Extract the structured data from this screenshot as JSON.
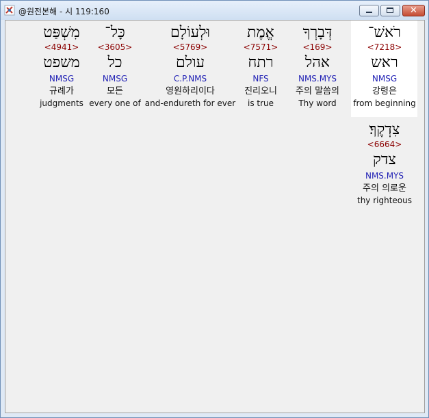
{
  "window": {
    "title": "@원전본해 - 시 119:160",
    "close_glyph": "✕"
  },
  "words": [
    {
      "hebrew": "רֹאשׁ־",
      "strong": "<7218>",
      "lemma": "ראש",
      "parse": "NMSG",
      "korean": "강령은",
      "english": "from beginning"
    },
    {
      "hebrew": "דְּבָרְךָ",
      "strong": "<169>",
      "lemma": "אהל",
      "parse": "NMS.MYS",
      "korean": "주의 말씀의",
      "english": "Thy word"
    },
    {
      "hebrew": "אֱמֶת",
      "strong": "<7571>",
      "lemma": "רתח",
      "parse": "NFS",
      "korean": "진리오니",
      "english": "is true"
    },
    {
      "hebrew": "וּלְעוֹלָם",
      "strong": "<5769>",
      "lemma": "עולם",
      "parse": "C.P.NMS",
      "korean": "영원하리이다",
      "english": "and-endureth for ever"
    },
    {
      "hebrew": "כָּל־",
      "strong": "<3605>",
      "lemma": "כל",
      "parse": "NMSG",
      "korean": "모든",
      "english": "every one of"
    },
    {
      "hebrew": "מִשְׁפַּט",
      "strong": "<4941>",
      "lemma": "משפט",
      "parse": "NMSG",
      "korean": "규례가",
      "english": "judgments"
    },
    {
      "hebrew": "צִדְקֶךָ׃",
      "strong": "<6664>",
      "lemma": "צדק",
      "parse": "NMS.MYS",
      "korean": "주의 의로운",
      "english": "thy righteous"
    }
  ]
}
